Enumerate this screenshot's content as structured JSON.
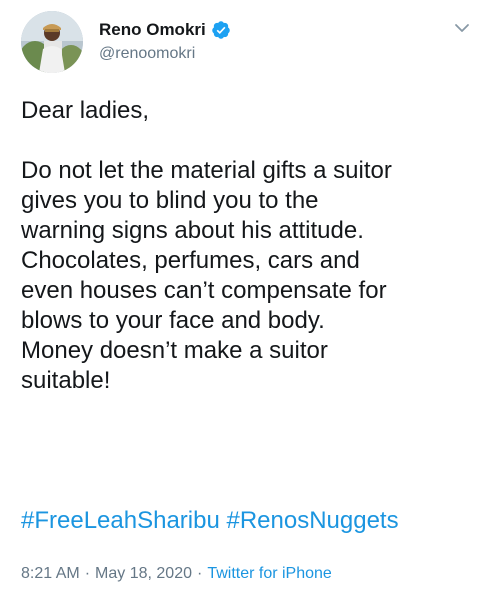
{
  "author": {
    "display_name": "Reno Omokri",
    "handle": "@renoomokri",
    "verified": true,
    "avatar_icon": "profile-photo"
  },
  "tweet": {
    "text": "Dear ladies,\n\nDo not let the material gifts a suitor\ngives you to blind you to the\nwarning signs about his attitude.\nChocolates, perfumes, cars and\neven houses can’t compensate for\nblows to your face and body.\nMoney doesn’t make a suitor\nsuitable!",
    "hashtags": [
      "#FreeLeahSharibu",
      "#RenosNuggets"
    ]
  },
  "meta": {
    "time": "8:21 AM",
    "separator": "·",
    "date": "May 18, 2020",
    "source": "Twitter for iPhone"
  },
  "colors": {
    "link": "#1b95e0",
    "secondary_text": "#657786",
    "primary_text": "#14171a",
    "verified_badge": "#1da1f2"
  }
}
